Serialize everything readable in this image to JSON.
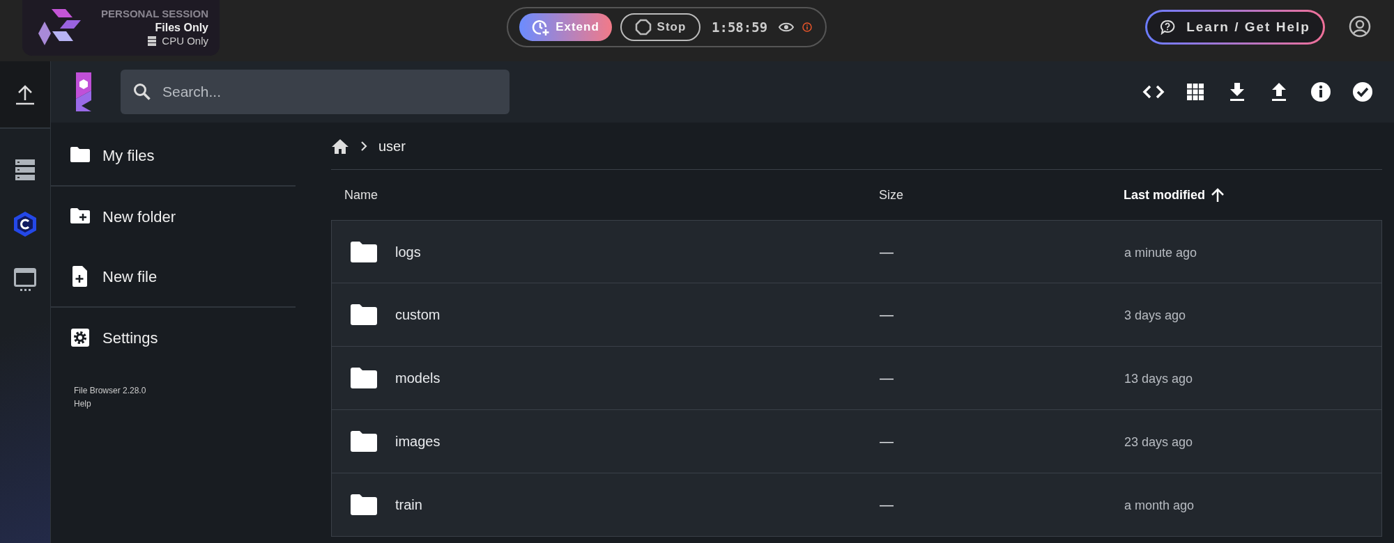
{
  "session": {
    "label": "PERSONAL SESSION",
    "plan": "Files Only",
    "hardware": "CPU Only"
  },
  "timer": {
    "extend": "Extend",
    "stop": "Stop",
    "time": "1:58:59"
  },
  "help_button": "Learn / Get Help",
  "search": {
    "placeholder": "Search..."
  },
  "sidebar": {
    "items": [
      {
        "label": "My files"
      },
      {
        "label": "New folder"
      },
      {
        "label": "New file"
      },
      {
        "label": "Settings"
      }
    ],
    "footer": [
      "File Browser 2.28.0",
      "Help"
    ]
  },
  "breadcrumbs": [
    "user"
  ],
  "table": {
    "columns": [
      {
        "label": "Name",
        "sorted": false
      },
      {
        "label": "Size",
        "sorted": false
      },
      {
        "label": "Last modified",
        "sorted": true
      }
    ],
    "rows": [
      {
        "name": "logs",
        "size": "—",
        "modified": "a minute ago"
      },
      {
        "name": "custom",
        "size": "—",
        "modified": "3 days ago"
      },
      {
        "name": "models",
        "size": "—",
        "modified": "13 days ago"
      },
      {
        "name": "images",
        "size": "—",
        "modified": "23 days ago"
      },
      {
        "name": "train",
        "size": "—",
        "modified": "a month ago"
      }
    ]
  }
}
